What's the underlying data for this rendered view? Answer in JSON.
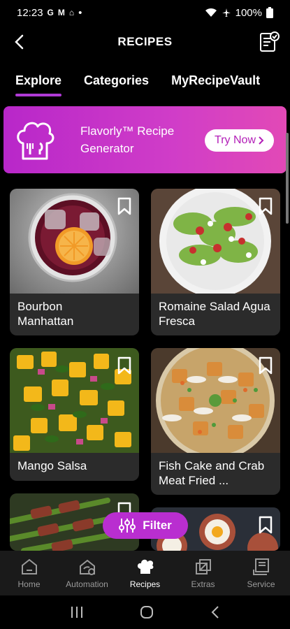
{
  "status": {
    "time": "12:23",
    "notif_icons": [
      "G",
      "M",
      "⌂"
    ],
    "battery": "100%"
  },
  "header": {
    "title": "RECIPES"
  },
  "tabs": [
    {
      "label": "Explore",
      "active": true
    },
    {
      "label": "Categories",
      "active": false
    },
    {
      "label": "MyRecipeVault",
      "active": false
    }
  ],
  "banner": {
    "text": "Flavorly™ Recipe Generator",
    "cta": "Try Now"
  },
  "cards": [
    {
      "title": "Bourbon Manhattan"
    },
    {
      "title": "Romaine Salad Agua Fresca"
    },
    {
      "title": "Mango Salsa"
    },
    {
      "title": "Fish Cake and Crab Meat Fried ..."
    },
    {
      "title": ""
    },
    {
      "title": ""
    }
  ],
  "filter": {
    "label": "Filter"
  },
  "nav": [
    {
      "label": "Home",
      "icon": "home-icon"
    },
    {
      "label": "Automation",
      "icon": "automation-icon"
    },
    {
      "label": "Recipes",
      "icon": "chef-hat-icon"
    },
    {
      "label": "Extras",
      "icon": "extras-icon"
    },
    {
      "label": "Service",
      "icon": "service-icon"
    }
  ],
  "colors": {
    "accent": "#b92ed0",
    "card_bg": "#2b2b2b"
  }
}
